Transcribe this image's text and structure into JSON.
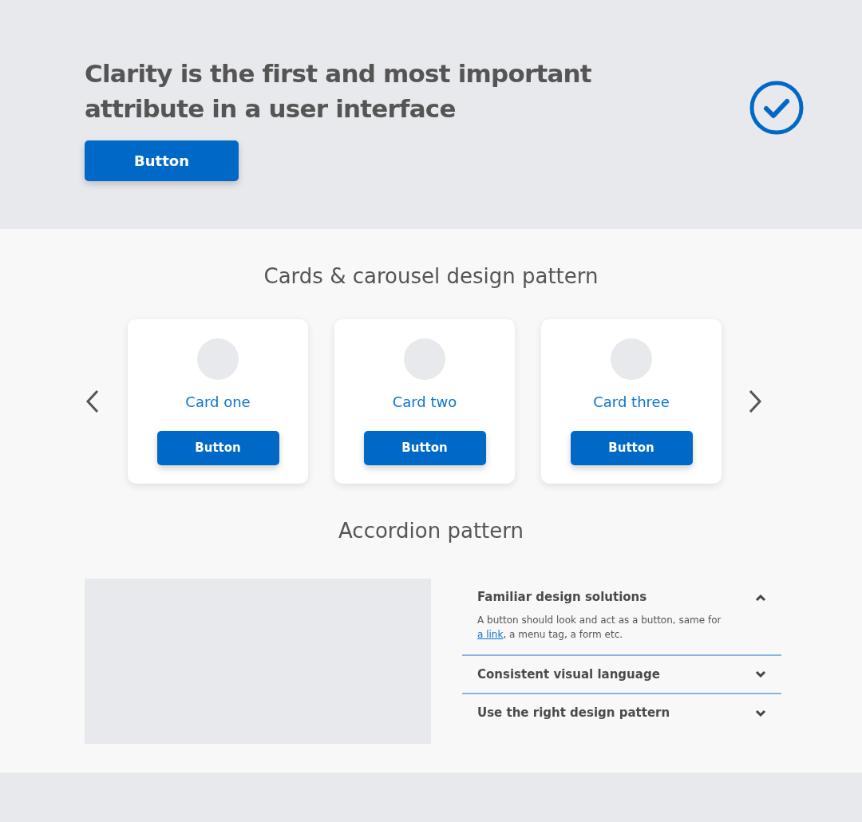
{
  "hero": {
    "headline": "Clarity is the first and most important attribute in a user interface",
    "button": "Button"
  },
  "cards_section": {
    "title": "Cards & carousel design pattern",
    "cards": [
      {
        "title": "Card one",
        "button": "Button"
      },
      {
        "title": "Card two",
        "button": "Button"
      },
      {
        "title": "Card three",
        "button": "Button"
      }
    ]
  },
  "accordion_section": {
    "title": "Accordion pattern",
    "items": [
      {
        "title": "Familiar design solutions",
        "expanded": true,
        "body_before": "A button should look and act as a button, same for",
        "link": "a link",
        "body_after": ", a menu tag, a form etc."
      },
      {
        "title": "Consistent visual language",
        "expanded": false
      },
      {
        "title": "Use the right design pattern",
        "expanded": false
      }
    ]
  }
}
